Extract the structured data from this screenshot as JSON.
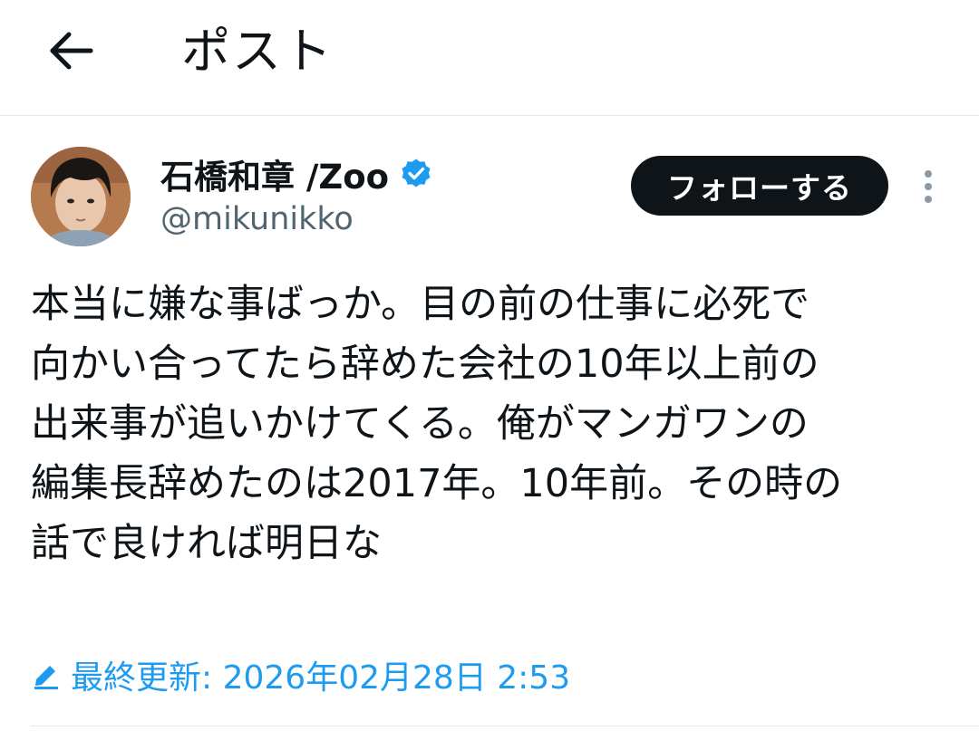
{
  "header": {
    "title": "ポスト",
    "back_icon": "arrow-left-icon"
  },
  "author": {
    "display_name": "石橋和章 /Zoo",
    "handle": "@mikunikko",
    "verified": true,
    "verified_icon": "verified-badge-icon",
    "avatar": "avatar-photo"
  },
  "follow_button": {
    "label": "フォローする"
  },
  "more_menu": {
    "icon": "more-vertical-icon"
  },
  "tweet": {
    "lines": [
      "本当に嫌な事ばっか。目の前の仕事に必死で",
      "向かい合ってたら辞めた会社の10年以上前の",
      "出来事が追いかけてくる。俺がマンガワンの",
      "編集長辞めたのは2017年。10年前。その時の",
      "話で良ければ明日な"
    ]
  },
  "edited": {
    "icon": "pencil-icon",
    "label": "最終更新: 2026年02月28日 2:53"
  },
  "colors": {
    "accent": "#1d9bf0",
    "text": "#0f1419",
    "secondary_text": "#536471",
    "button_bg": "#0f1419",
    "divider": "#e6e8ea"
  }
}
